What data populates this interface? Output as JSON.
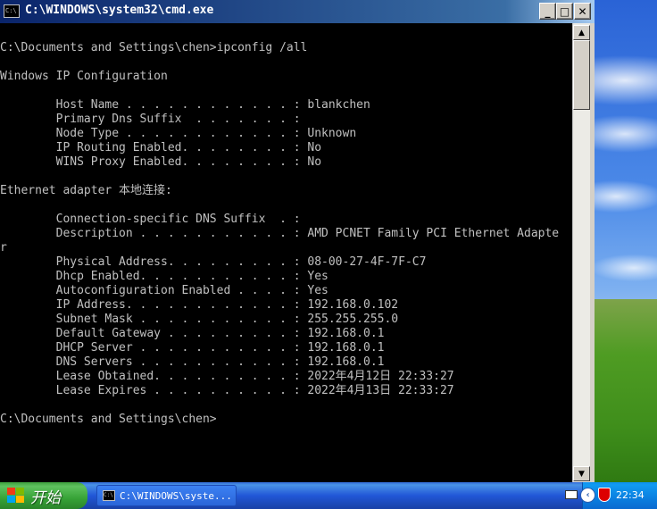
{
  "window": {
    "title": "C:\\WINDOWS\\system32\\cmd.exe",
    "min_glyph": "_",
    "max_glyph": "□",
    "close_glyph": "✕"
  },
  "console_lines": [
    "C:\\Documents and Settings\\chen>ipconfig /all",
    "",
    "Windows IP Configuration",
    "",
    "        Host Name . . . . . . . . . . . . : blankchen",
    "        Primary Dns Suffix  . . . . . . . :",
    "        Node Type . . . . . . . . . . . . : Unknown",
    "        IP Routing Enabled. . . . . . . . : No",
    "        WINS Proxy Enabled. . . . . . . . : No",
    "",
    "Ethernet adapter 本地连接:",
    "",
    "        Connection-specific DNS Suffix  . :",
    "        Description . . . . . . . . . . . : AMD PCNET Family PCI Ethernet Adapte",
    "r",
    "        Physical Address. . . . . . . . . : 08-00-27-4F-7F-C7",
    "        Dhcp Enabled. . . . . . . . . . . : Yes",
    "        Autoconfiguration Enabled . . . . : Yes",
    "        IP Address. . . . . . . . . . . . : 192.168.0.102",
    "        Subnet Mask . . . . . . . . . . . : 255.255.255.0",
    "        Default Gateway . . . . . . . . . : 192.168.0.1",
    "        DHCP Server . . . . . . . . . . . : 192.168.0.1",
    "        DNS Servers . . . . . . . . . . . : 192.168.0.1",
    "        Lease Obtained. . . . . . . . . . : 2022年4月12日 22:33:27",
    "        Lease Expires . . . . . . . . . . : 2022年4月13日 22:33:27",
    "",
    "C:\\Documents and Settings\\chen>"
  ],
  "taskbar": {
    "start_label": "开始",
    "task_button_label": "C:\\WINDOWS\\syste...",
    "clock": "22:34"
  },
  "icons": {
    "title": "console-icon",
    "start": "windows-flag-icon",
    "tray_keyboard": "keyboard-icon",
    "tray_chevron": "chevron-left-icon",
    "tray_security": "security-shield-icon"
  },
  "colors": {
    "console_bg": "#000000",
    "console_fg": "#c0c0c0",
    "titlebar_start": "#0a246a",
    "titlebar_end": "#a6caf0"
  }
}
